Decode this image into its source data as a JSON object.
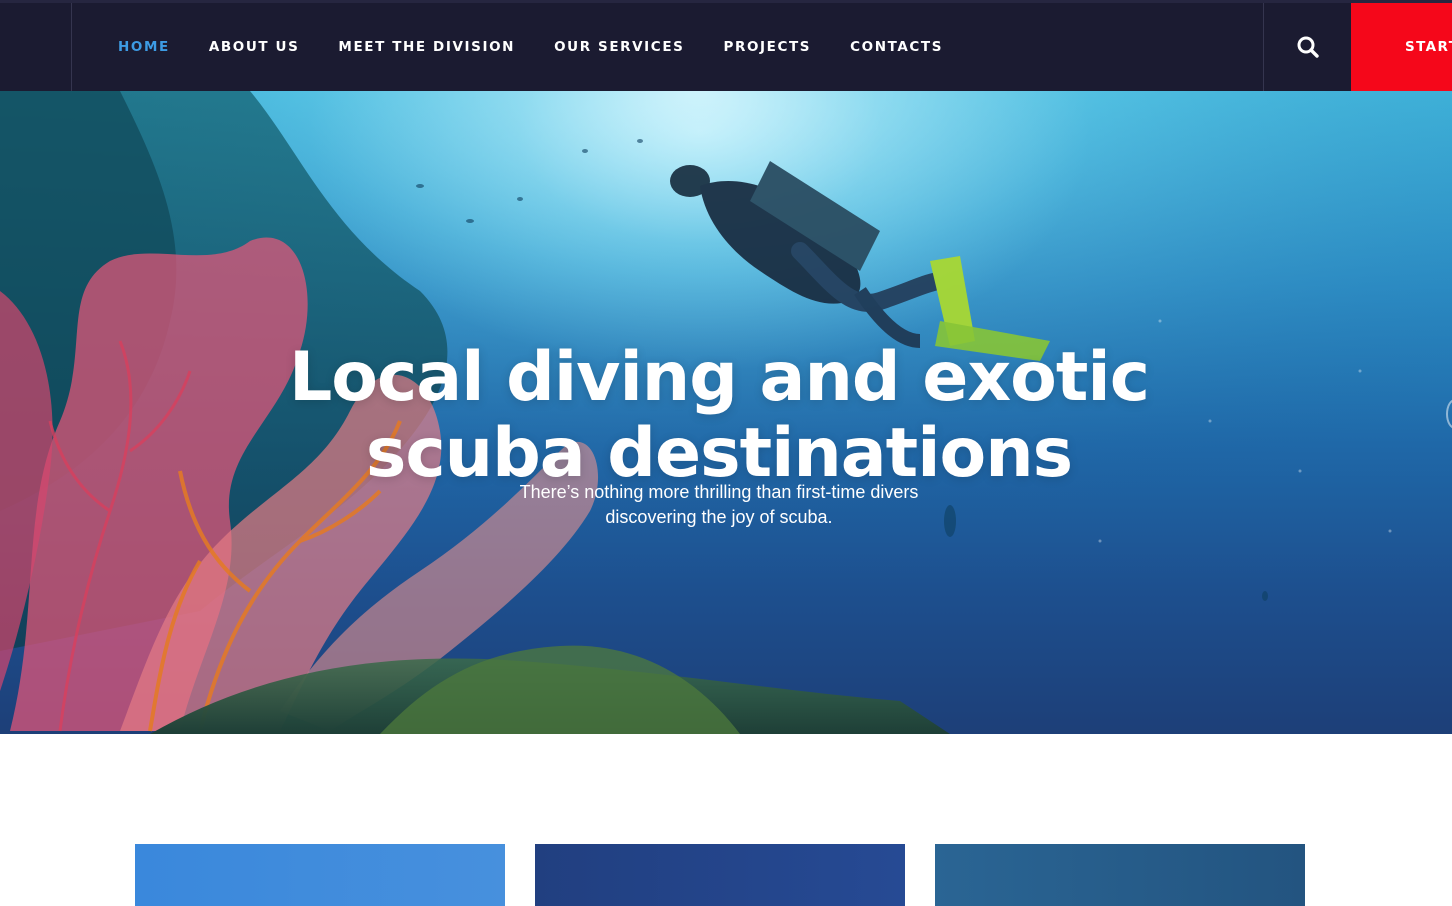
{
  "nav": {
    "items": [
      {
        "label": "HOME",
        "active": true
      },
      {
        "label": "ABOUT US",
        "active": false
      },
      {
        "label": "MEET THE DIVISION",
        "active": false
      },
      {
        "label": "OUR SERVICES",
        "active": false
      },
      {
        "label": "PROJECTS",
        "active": false
      },
      {
        "label": "CONTACTS",
        "active": false
      }
    ],
    "search_icon": "search-icon",
    "cta_label": "START"
  },
  "hero": {
    "title_line1": "Local diving and exotic",
    "title_line2": "scuba destinations",
    "subtitle_line1": "There’s nothing more thrilling than first-time divers",
    "subtitle_line2": "discovering the joy of scuba."
  },
  "colors": {
    "header_bg": "#1b1b31",
    "nav_active": "#3d9be4",
    "cta_bg": "#f5071a",
    "card1": "#3a88dc",
    "card2": "#213f80",
    "card3": "#2a6594"
  }
}
